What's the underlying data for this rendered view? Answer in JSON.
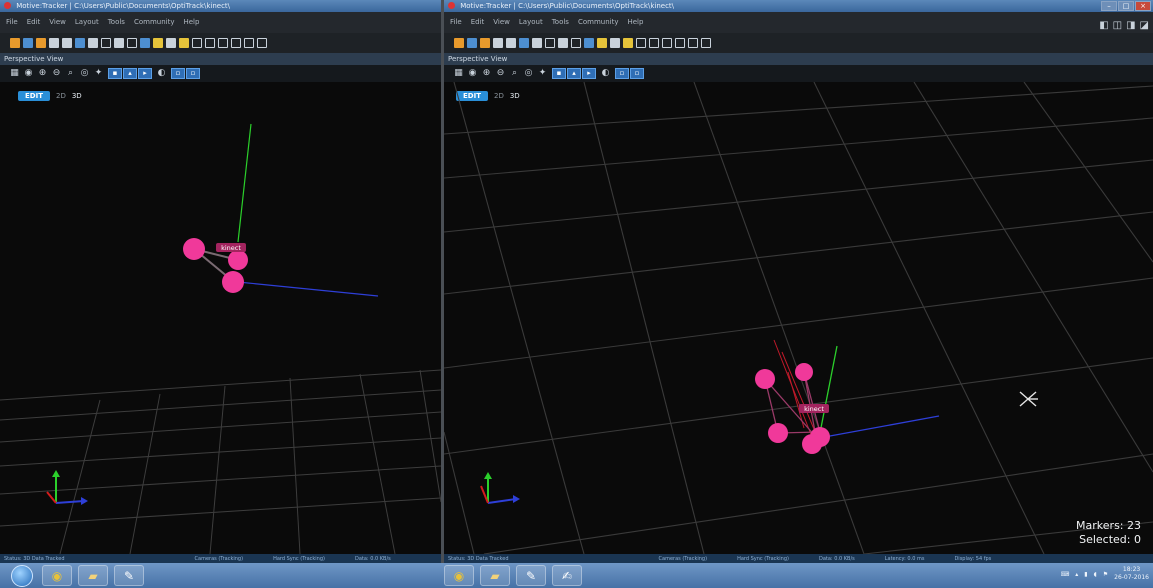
{
  "left_window": {
    "title": "Motive:Tracker | C:\\Users\\Public\\Documents\\OptiTrack\\kinect\\",
    "menu": [
      "File",
      "Edit",
      "View",
      "Layout",
      "Tools",
      "Community",
      "Help"
    ],
    "panel_title": "Perspective View",
    "mode": {
      "edit": "EDIT",
      "two_d": "2D",
      "three_d": "3D"
    },
    "rigid_body_label": "kinect",
    "status": {
      "status": "Status: 3D Data Tracked",
      "cameras": "Cameras (Tracking)",
      "hard_sync": "Hard Sync (Tracking)",
      "data_rate": "Data: 0.0 KB/s"
    }
  },
  "right_window": {
    "title": "Motive:Tracker | C:\\Users\\Public\\Documents\\OptiTrack\\kinect\\",
    "menu": [
      "File",
      "Edit",
      "View",
      "Layout",
      "Tools",
      "Community",
      "Help"
    ],
    "panel_title": "Perspective View",
    "mode": {
      "edit": "EDIT",
      "two_d": "2D",
      "three_d": "3D"
    },
    "rigid_body_label": "kinect",
    "markers_text": "Markers: 23",
    "selected_text": "Selected: 0",
    "status": {
      "status": "Status: 3D Data Tracked",
      "cameras": "Cameras (Tracking)",
      "hard_sync": "Hard Sync (Tracking)",
      "data_rate": "Data: 0.0 KB/s",
      "latency": "Latency: 0.0 ms",
      "display": "Display: 54 fps"
    }
  },
  "taskbar": {
    "apps": [
      "chrome-icon",
      "folder-icon",
      "paint-icon",
      "notepad-icon"
    ],
    "clock_time": "18:23",
    "clock_date": "26-07-2016"
  },
  "colors": {
    "marker": "#f0399a",
    "grid": "#3a3a3a",
    "axis_y": "#2bd02b",
    "axis_x": "#2e3fd8",
    "axis_z": "#d41c1c",
    "accent": "#2a8fd8"
  }
}
